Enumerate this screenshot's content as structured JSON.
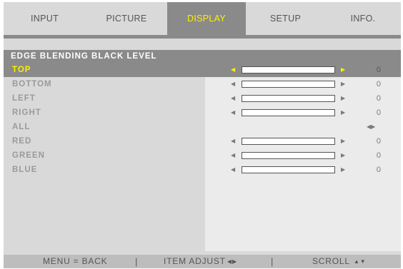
{
  "tabs": [
    {
      "label": "INPUT"
    },
    {
      "label": "PICTURE"
    },
    {
      "label": "DISPLAY"
    },
    {
      "label": "SETUP"
    },
    {
      "label": "INFO."
    }
  ],
  "active_tab": "DISPLAY",
  "section_title": "EDGE BLENDING BLACK LEVEL",
  "rows": [
    {
      "label": "TOP",
      "value": "0",
      "level": 0,
      "selected": true
    },
    {
      "label": "BOTTOM",
      "value": "0",
      "level": 0
    },
    {
      "label": "LEFT",
      "value": "0",
      "level": 0
    },
    {
      "label": "RIGHT",
      "value": "0",
      "level": 0
    },
    {
      "label": "ALL",
      "icon": "left-right-arrows-icon"
    },
    {
      "label": "RED",
      "value": "0",
      "level": 0
    },
    {
      "label": "GREEN",
      "value": "0",
      "level": 0
    },
    {
      "label": "BLUE",
      "value": "0",
      "level": 0
    }
  ],
  "footer": {
    "menu_back": "MENU = BACK",
    "item_adjust": "ITEM ADJUST",
    "scroll": "SCROLL",
    "separator": "|"
  },
  "colors": {
    "accent": "#ffee00",
    "tab_active_bg": "#8a8a8a",
    "panel_bg": "#d9d9d9",
    "value_panel_bg": "#ebebeb",
    "footer_bg": "#bdbdbd"
  }
}
